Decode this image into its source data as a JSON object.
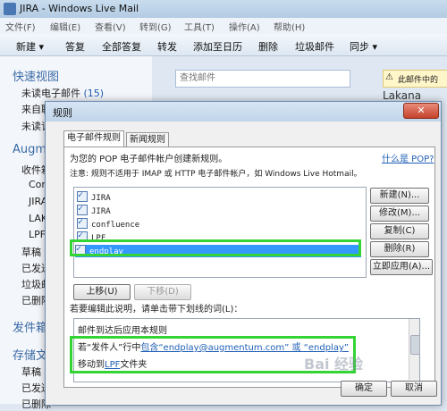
{
  "window": {
    "title": "JIRA - Windows Live Mail",
    "menu": [
      "文件(F)",
      "编辑(E)",
      "查看(V)",
      "转到(G)",
      "工具(T)",
      "操作(A)",
      "帮助(H)"
    ],
    "toolbar": [
      "新建 ▾",
      "答复",
      "全部答复",
      "转发",
      "添加至日历",
      "删除",
      "垃圾邮件",
      "同步 ▾"
    ]
  },
  "nav": {
    "quick_views": "快速视图",
    "unread": "未读电子邮件",
    "unread_count": "(15)",
    "item2": "来自联",
    "item3": "未读订",
    "account": "Augme",
    "inbox": "收件箱",
    "conf": "Conf",
    "jira": "JIRA",
    "laka": "LAKA",
    "lpf": "LPF",
    "drafts": "草稿",
    "sent": "已发送",
    "junk": "垃圾邮",
    "deleted": "已删除",
    "outbox": "发件箱",
    "storage": "存储文",
    "s_drafts": "草稿",
    "s_sent": "已发送",
    "s_deleted": "已删除"
  },
  "search": {
    "placeholder": "查找邮件"
  },
  "warning": "此邮件中的",
  "right_header": "Lakana Augu",
  "dialog": {
    "title": "规则",
    "close": "✕",
    "tabs": [
      "电子邮件规则",
      "新闻规则"
    ],
    "intro": "为您的 POP 电子邮件帐户创建新规则。",
    "what_is_pop": "什么是 POP?",
    "note": "注意: 规则不适用于 IMAP 或 HTTP 电子邮件帐户，如 Windows Live Hotmail。",
    "rules": [
      "JIRA",
      "JIRA",
      "confluence",
      "LPF",
      "endplay"
    ],
    "selected_rule": "endplay",
    "buttons": {
      "new": "新建(N)...",
      "modify": "修改(M)...",
      "copy": "复制(C)",
      "delete": "删除(R)",
      "apply_now": "立即应用(A)...",
      "move_up": "上移(U)",
      "move_down": "下移(D)",
      "ok": "确定",
      "cancel": "取消"
    },
    "desc_label": "若要编辑此说明，请单击带下划线的词(L)：",
    "desc": {
      "line1": "邮件到达后应用本规则",
      "line2_pre": "若“发件人”行中",
      "line2_link": "包含“endplay@augmentum.com” 或 “endplay”",
      "line3_pre": "移动到",
      "line3_link": "LPF",
      "line3_post": "文件夹"
    }
  },
  "watermark": "Bai 经验"
}
